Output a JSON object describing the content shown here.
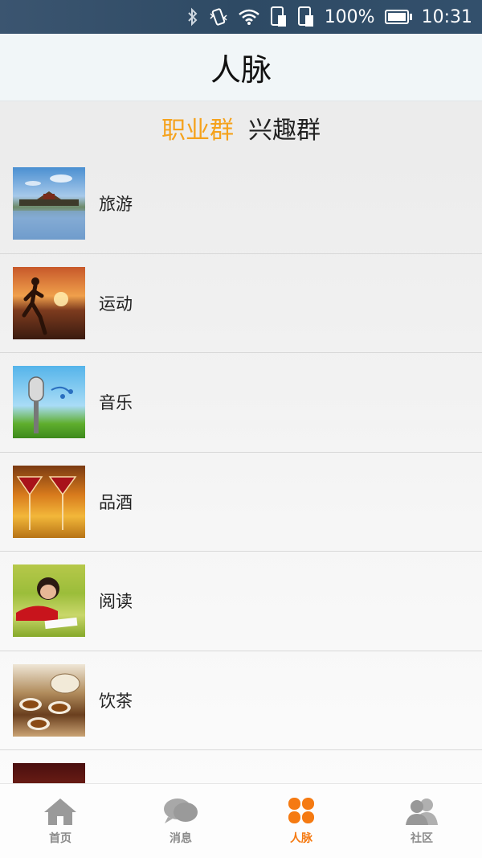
{
  "status_bar": {
    "battery_percent": "100%",
    "time": "10:31",
    "icons": [
      "bluetooth-icon",
      "vibrate-icon",
      "wifi-icon",
      "sim1-icon",
      "sim2-icon",
      "battery-icon"
    ]
  },
  "header": {
    "title": "人脉"
  },
  "segments": {
    "items": [
      {
        "label": "职业群",
        "active": true
      },
      {
        "label": "兴趣群",
        "active": false
      }
    ],
    "active_color": "#f5a21c"
  },
  "groups": [
    {
      "label": "旅游",
      "image": "travel-thumbnail"
    },
    {
      "label": "运动",
      "image": "sport-thumbnail"
    },
    {
      "label": "音乐",
      "image": "music-thumbnail"
    },
    {
      "label": "品酒",
      "image": "wine-thumbnail"
    },
    {
      "label": "阅读",
      "image": "reading-thumbnail"
    },
    {
      "label": "饮茶",
      "image": "tea-thumbnail"
    },
    {
      "label": "",
      "image": "chess-thumbnail"
    }
  ],
  "bottom_nav": {
    "items": [
      {
        "label": "首页",
        "icon": "home-icon",
        "active": false
      },
      {
        "label": "消息",
        "icon": "message-icon",
        "active": false
      },
      {
        "label": "人脉",
        "icon": "clover-icon",
        "active": true
      },
      {
        "label": "社区",
        "icon": "community-icon",
        "active": false
      }
    ],
    "active_color": "#f57a12"
  }
}
